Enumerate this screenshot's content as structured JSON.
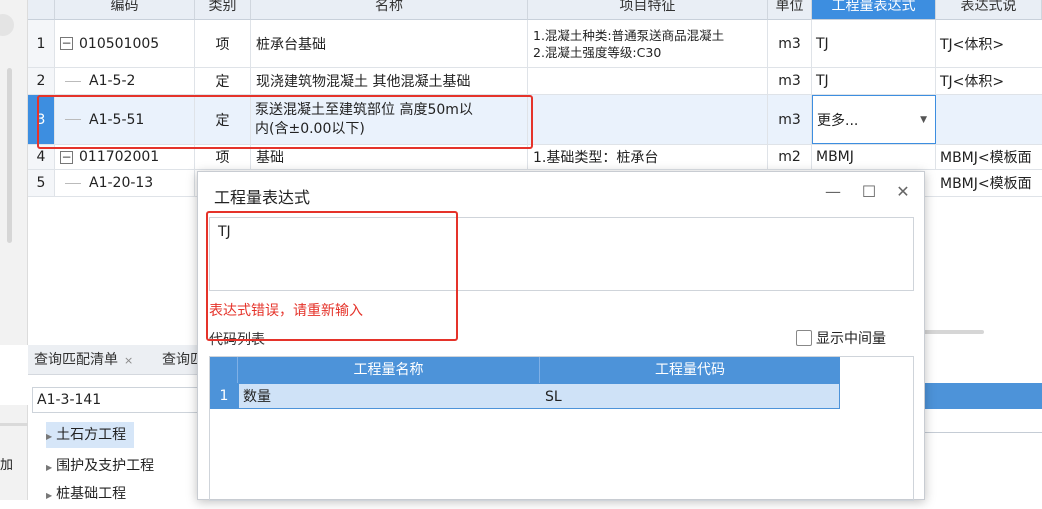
{
  "grid": {
    "headers": {
      "code": "编码",
      "type": "类别",
      "name": "名称",
      "features": "项目特征",
      "unit": "单位",
      "expression": "工程量表达式",
      "expr_text": "表达式说"
    },
    "rows": [
      {
        "num": "1",
        "toggle": "−",
        "code": "010501005",
        "type": "项",
        "name": "桩承台基础",
        "features": [
          "1.混凝土种类:普通泵送商品混凝土",
          "2.混凝土强度等级:C30"
        ],
        "unit": "m3",
        "expression": "TJ",
        "expr_text": "TJ<体积>"
      },
      {
        "num": "2",
        "code": "A1-5-2",
        "type": "定",
        "name": "现浇建筑物混凝土 其他混凝土基础",
        "unit": "m3",
        "expression": "TJ",
        "expr_text": "TJ<体积>"
      },
      {
        "num": "3",
        "code": "A1-5-51",
        "type": "定",
        "name": [
          "泵送混凝土至建筑部位 高度50m以",
          "内(含±0.00以下)"
        ],
        "unit": "m3",
        "expression": "更多...",
        "expr_text": ""
      },
      {
        "num": "4",
        "toggle": "−",
        "code": "011702001",
        "type": "项",
        "name": "基础",
        "features": "1.基础类型：桩承台",
        "unit": "m2",
        "expression": "MBMJ",
        "expr_text": "MBMJ<模板面"
      },
      {
        "num": "5",
        "code": "A1-20-13",
        "expr_text": "MBMJ<模板面"
      }
    ]
  },
  "bottom_panel": {
    "tabs": [
      "查询匹配清单",
      "查询匹"
    ],
    "tab_close": "×",
    "search_value": "A1-3-141",
    "tree": [
      "土石方工程",
      "围护及支护工程",
      "桩基础工程"
    ]
  },
  "left_edge_text": "加",
  "dialog": {
    "title": "工程量表达式",
    "min": "—",
    "max": "☐",
    "close": "✕",
    "expression_value": "TJ",
    "error": "表达式错误，请重新输入",
    "code_list_label": "代码列表",
    "show_intermediate": "显示中间量",
    "code_grid": {
      "headers": [
        "工程量名称",
        "工程量代码"
      ],
      "rows": [
        {
          "num": "1",
          "name": "数量",
          "code": "SL"
        }
      ]
    }
  },
  "colors": {
    "accent": "#3d8ee0",
    "error_red": "#e5332a",
    "selected_row": "#eaf2fc"
  }
}
